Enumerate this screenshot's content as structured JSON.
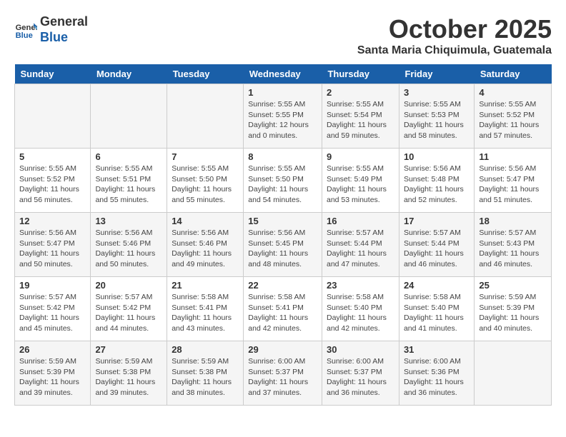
{
  "header": {
    "logo_line1": "General",
    "logo_line2": "Blue",
    "month_title": "October 2025",
    "location": "Santa Maria Chiquimula, Guatemala"
  },
  "weekdays": [
    "Sunday",
    "Monday",
    "Tuesday",
    "Wednesday",
    "Thursday",
    "Friday",
    "Saturday"
  ],
  "weeks": [
    [
      {
        "day": "",
        "info": ""
      },
      {
        "day": "",
        "info": ""
      },
      {
        "day": "",
        "info": ""
      },
      {
        "day": "1",
        "info": "Sunrise: 5:55 AM\nSunset: 5:55 PM\nDaylight: 12 hours\nand 0 minutes."
      },
      {
        "day": "2",
        "info": "Sunrise: 5:55 AM\nSunset: 5:54 PM\nDaylight: 11 hours\nand 59 minutes."
      },
      {
        "day": "3",
        "info": "Sunrise: 5:55 AM\nSunset: 5:53 PM\nDaylight: 11 hours\nand 58 minutes."
      },
      {
        "day": "4",
        "info": "Sunrise: 5:55 AM\nSunset: 5:52 PM\nDaylight: 11 hours\nand 57 minutes."
      }
    ],
    [
      {
        "day": "5",
        "info": "Sunrise: 5:55 AM\nSunset: 5:52 PM\nDaylight: 11 hours\nand 56 minutes."
      },
      {
        "day": "6",
        "info": "Sunrise: 5:55 AM\nSunset: 5:51 PM\nDaylight: 11 hours\nand 55 minutes."
      },
      {
        "day": "7",
        "info": "Sunrise: 5:55 AM\nSunset: 5:50 PM\nDaylight: 11 hours\nand 55 minutes."
      },
      {
        "day": "8",
        "info": "Sunrise: 5:55 AM\nSunset: 5:50 PM\nDaylight: 11 hours\nand 54 minutes."
      },
      {
        "day": "9",
        "info": "Sunrise: 5:55 AM\nSunset: 5:49 PM\nDaylight: 11 hours\nand 53 minutes."
      },
      {
        "day": "10",
        "info": "Sunrise: 5:56 AM\nSunset: 5:48 PM\nDaylight: 11 hours\nand 52 minutes."
      },
      {
        "day": "11",
        "info": "Sunrise: 5:56 AM\nSunset: 5:47 PM\nDaylight: 11 hours\nand 51 minutes."
      }
    ],
    [
      {
        "day": "12",
        "info": "Sunrise: 5:56 AM\nSunset: 5:47 PM\nDaylight: 11 hours\nand 50 minutes."
      },
      {
        "day": "13",
        "info": "Sunrise: 5:56 AM\nSunset: 5:46 PM\nDaylight: 11 hours\nand 50 minutes."
      },
      {
        "day": "14",
        "info": "Sunrise: 5:56 AM\nSunset: 5:46 PM\nDaylight: 11 hours\nand 49 minutes."
      },
      {
        "day": "15",
        "info": "Sunrise: 5:56 AM\nSunset: 5:45 PM\nDaylight: 11 hours\nand 48 minutes."
      },
      {
        "day": "16",
        "info": "Sunrise: 5:57 AM\nSunset: 5:44 PM\nDaylight: 11 hours\nand 47 minutes."
      },
      {
        "day": "17",
        "info": "Sunrise: 5:57 AM\nSunset: 5:44 PM\nDaylight: 11 hours\nand 46 minutes."
      },
      {
        "day": "18",
        "info": "Sunrise: 5:57 AM\nSunset: 5:43 PM\nDaylight: 11 hours\nand 46 minutes."
      }
    ],
    [
      {
        "day": "19",
        "info": "Sunrise: 5:57 AM\nSunset: 5:42 PM\nDaylight: 11 hours\nand 45 minutes."
      },
      {
        "day": "20",
        "info": "Sunrise: 5:57 AM\nSunset: 5:42 PM\nDaylight: 11 hours\nand 44 minutes."
      },
      {
        "day": "21",
        "info": "Sunrise: 5:58 AM\nSunset: 5:41 PM\nDaylight: 11 hours\nand 43 minutes."
      },
      {
        "day": "22",
        "info": "Sunrise: 5:58 AM\nSunset: 5:41 PM\nDaylight: 11 hours\nand 42 minutes."
      },
      {
        "day": "23",
        "info": "Sunrise: 5:58 AM\nSunset: 5:40 PM\nDaylight: 11 hours\nand 42 minutes."
      },
      {
        "day": "24",
        "info": "Sunrise: 5:58 AM\nSunset: 5:40 PM\nDaylight: 11 hours\nand 41 minutes."
      },
      {
        "day": "25",
        "info": "Sunrise: 5:59 AM\nSunset: 5:39 PM\nDaylight: 11 hours\nand 40 minutes."
      }
    ],
    [
      {
        "day": "26",
        "info": "Sunrise: 5:59 AM\nSunset: 5:39 PM\nDaylight: 11 hours\nand 39 minutes."
      },
      {
        "day": "27",
        "info": "Sunrise: 5:59 AM\nSunset: 5:38 PM\nDaylight: 11 hours\nand 39 minutes."
      },
      {
        "day": "28",
        "info": "Sunrise: 5:59 AM\nSunset: 5:38 PM\nDaylight: 11 hours\nand 38 minutes."
      },
      {
        "day": "29",
        "info": "Sunrise: 6:00 AM\nSunset: 5:37 PM\nDaylight: 11 hours\nand 37 minutes."
      },
      {
        "day": "30",
        "info": "Sunrise: 6:00 AM\nSunset: 5:37 PM\nDaylight: 11 hours\nand 36 minutes."
      },
      {
        "day": "31",
        "info": "Sunrise: 6:00 AM\nSunset: 5:36 PM\nDaylight: 11 hours\nand 36 minutes."
      },
      {
        "day": "",
        "info": ""
      }
    ]
  ]
}
